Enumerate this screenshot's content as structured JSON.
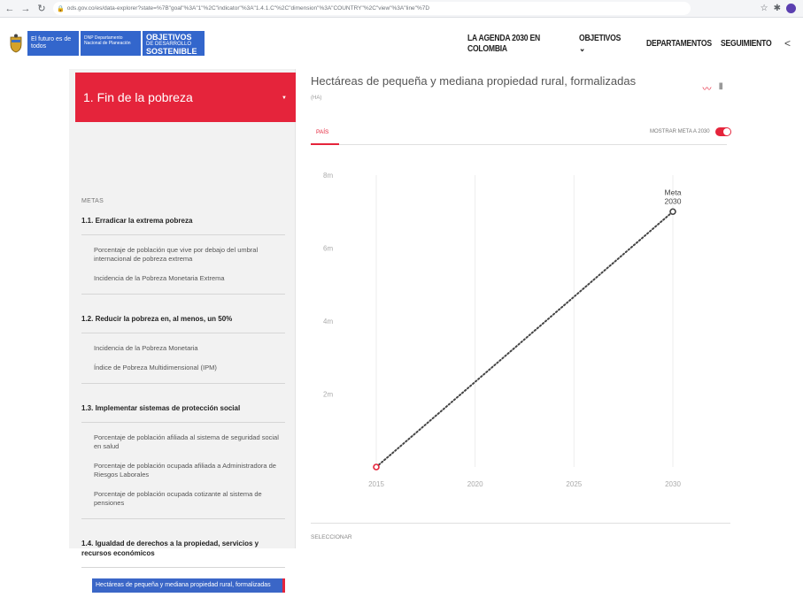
{
  "browser": {
    "url": "ods.gov.co/es/data-explorer?state=%7B\"goal\"%3A\"1\"%2C\"indicator\"%3A\"1.4.1.C\"%2C\"dimension\"%3A\"COUNTRY\"%2C\"view\"%3A\"line\"%7D"
  },
  "header": {
    "gov_label": "El futuro es de todos",
    "dnp_label": "DNP Departamento Nacional de Planeación",
    "ods_line1": "OBJETIVOS",
    "ods_line2": "DE DESARROLLO",
    "ods_line3": "SOSTENIBLE",
    "nav": [
      "LA AGENDA 2030 EN COLOMBIA",
      "OBJETIVOS",
      "DEPARTAMENTOS",
      "SEGUIMIENTO"
    ]
  },
  "sidebar": {
    "goal": "1. Fin de la pobreza",
    "metas_label": "METAS",
    "metas": [
      {
        "title": "1.1. Erradicar la extrema pobreza",
        "indicators": [
          "Porcentaje de población que vive por debajo del umbral internacional de pobreza extrema",
          "Incidencia de la Pobreza Monetaria Extrema"
        ]
      },
      {
        "title": "1.2. Reducir la pobreza en, al menos, un 50%",
        "indicators": [
          "Incidencia de la Pobreza Monetaria",
          "Índice de Pobreza Multidimensional (IPM)"
        ]
      },
      {
        "title": "1.3. Implementar sistemas de protección social",
        "indicators": [
          "Porcentaje de población afiliada al sistema de seguridad social en salud",
          "Porcentaje de población ocupada afiliada a Administradora de Riesgos Laborales",
          "Porcentaje de población ocupada cotizante al sistema de pensiones"
        ]
      },
      {
        "title": "1.4. Igualdad de derechos a la propiedad, servicios y recursos económicos",
        "indicators": [
          "Hectáreas de pequeña y mediana propiedad rural, formalizadas"
        ],
        "active_indicator": 0
      }
    ]
  },
  "panel": {
    "title": "Hectáreas de pequeña y mediana propiedad rural, formalizadas",
    "unit": "(HA)",
    "tab": "PAÍS",
    "toggle_label": "MOSTRAR META A 2030",
    "toggle_on": true,
    "select_label": "SELECCIONAR",
    "accent": "#e5243b"
  },
  "chart_data": {
    "type": "line",
    "title": "",
    "xlabel": "",
    "ylabel": "",
    "x": [
      2015,
      2030
    ],
    "series": [
      {
        "values": [
          0,
          7000000
        ]
      }
    ],
    "annotations": [
      {
        "x": 2030,
        "y": 7000000,
        "text_line1": "Meta",
        "text_line2": "2030"
      }
    ],
    "x_ticks": [
      "2015",
      "2020",
      "2025",
      "2030"
    ],
    "y_ticks": [
      {
        "value": 2000000,
        "label": "2m"
      },
      {
        "value": 4000000,
        "label": "4m"
      },
      {
        "value": 6000000,
        "label": "6m"
      },
      {
        "value": 8000000,
        "label": "8m"
      }
    ],
    "xlim": [
      2015,
      2030
    ],
    "ylim": [
      0,
      8000000
    ],
    "line_style": "dotted",
    "grid": "vertical",
    "colors": {
      "line": "#444444",
      "start_point": "#e5243b",
      "end_point": "#444444"
    }
  }
}
